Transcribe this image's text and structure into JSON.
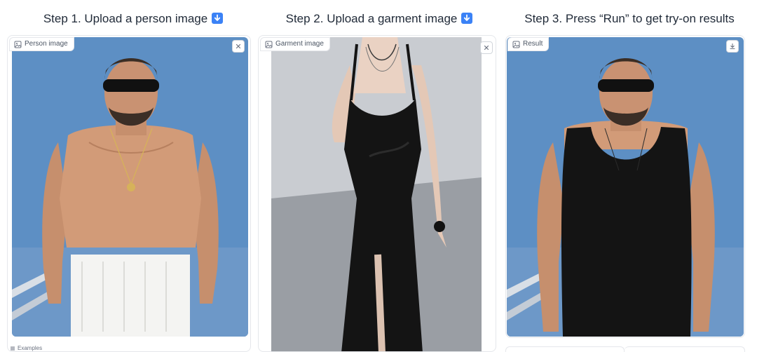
{
  "steps": [
    {
      "title": "Step 1. Upload a person image",
      "emoji": "down-arrow-emoji-icon"
    },
    {
      "title": "Step 2. Upload a garment image",
      "emoji": "down-arrow-emoji-icon"
    },
    {
      "title": "Step 3. Press “Run” to get try-on results"
    }
  ],
  "person_panel": {
    "label": "Person image",
    "icon": "image-icon",
    "action_icon": "close-icon"
  },
  "garment_panel": {
    "label": "Garment image",
    "icon": "image-icon",
    "action_icon": "close-icon"
  },
  "result_panel": {
    "label": "Result",
    "icon": "image-icon",
    "action_icon": "download-icon"
  },
  "examples": {
    "label": "Examples",
    "icon": "list-icon"
  },
  "colors": {
    "accent": "#3b82f6",
    "sky": "#5d8fc4",
    "garment_bg": "#c9ccd1",
    "dress": "#141414"
  }
}
